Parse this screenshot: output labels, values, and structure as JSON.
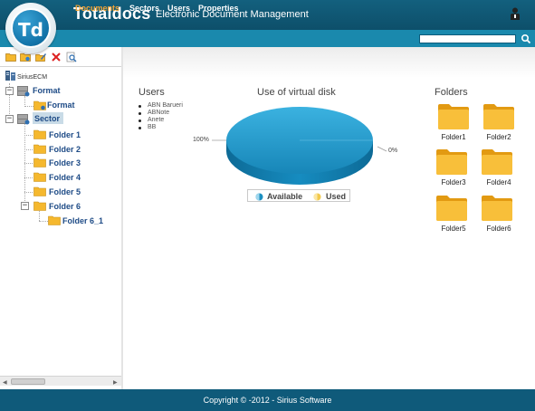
{
  "header": {
    "logo_text": "Td",
    "title": "Totaldocs",
    "subtitle": "Electronic Document Management"
  },
  "nav": {
    "items": [
      {
        "label": "Documents",
        "active": true
      },
      {
        "label": "Sectors",
        "active": false
      },
      {
        "label": "Users",
        "active": false
      },
      {
        "label": "Properties",
        "active": false
      }
    ],
    "search_value": ""
  },
  "toolbar": {
    "icons": [
      "open-folder-icon",
      "new-folder-icon",
      "edit-icon",
      "delete-icon",
      "find-icon"
    ]
  },
  "tree": {
    "root": "SiriusECM",
    "format_group": "Format",
    "format_child": "Format",
    "sector_group": "Sector",
    "folders": [
      "Folder 1",
      "Folder 2",
      "Folder 3",
      "Folder 4",
      "Folder 5",
      "Folder 6"
    ],
    "subfolder": "Folder 6_1"
  },
  "users": {
    "title": "Users",
    "items": [
      "ABN Barueri",
      "ABNote",
      "Anete",
      "BB"
    ]
  },
  "disk": {
    "title": "Use of virtual disk",
    "label_left": "100%",
    "label_right": "0%",
    "legend_available": "Available",
    "legend_used": "Used",
    "available_percent": 100,
    "used_percent": 0,
    "color_available": "#1b8fc0",
    "color_used": "#f2c94c"
  },
  "folders": {
    "title": "Folders",
    "items": [
      "Folder1",
      "Folder2",
      "Folder3",
      "Folder4",
      "Folder5",
      "Folder6"
    ]
  },
  "footer": {
    "text": "Copyright © -2012 - Sirius Software"
  },
  "colors": {
    "header_bg": "#0f5a7a",
    "nav_bg": "#1a89ad",
    "nav_active": "#f6a534",
    "folder": "#f5b82e"
  }
}
